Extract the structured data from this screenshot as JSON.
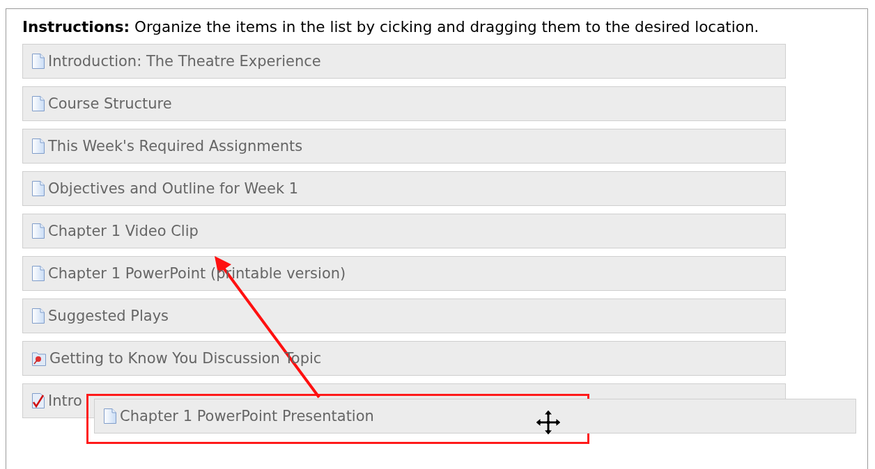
{
  "instructions": "**Instructions:** Organize the items in the list by cicking and dragging them to the desired location.",
  "items": [
    {
      "kind": "page",
      "label": "Introduction: The Theatre Experience"
    },
    {
      "kind": "page",
      "label": "Course Structure"
    },
    {
      "kind": "page",
      "label": "This Week's Required Assignments"
    },
    {
      "kind": "page",
      "label": "Objectives and Outline for Week 1"
    },
    {
      "kind": "page",
      "label": "Chapter 1 Video Clip"
    },
    {
      "kind": "page",
      "label": "Chapter 1 PowerPoint (printable version)"
    },
    {
      "kind": "page",
      "label": "Suggested Plays"
    },
    {
      "kind": "discussion",
      "label": "Getting to Know You Discussion Topic"
    },
    {
      "kind": "quiz",
      "label": "Intro"
    }
  ],
  "dragged_item": {
    "kind": "page",
    "label": "Chapter 1 PowerPoint Presentation"
  }
}
